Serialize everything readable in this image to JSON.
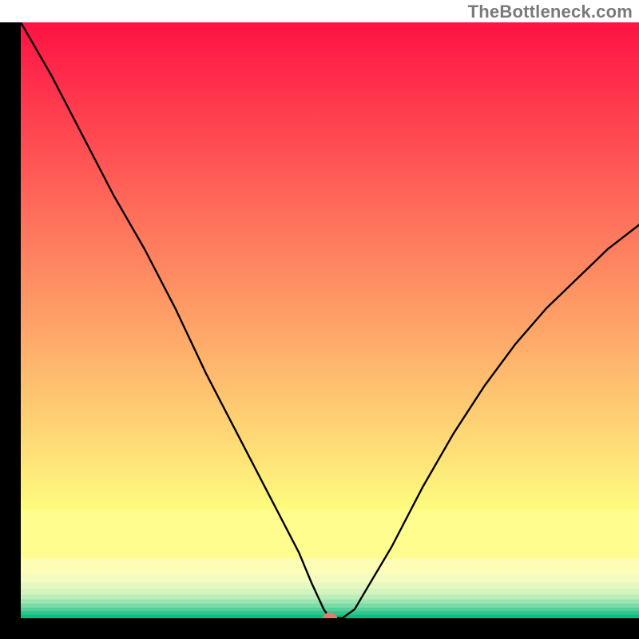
{
  "watermark": {
    "text": "TheBottleneck.com"
  },
  "chart_data": {
    "type": "line",
    "title": "",
    "xlabel": "",
    "ylabel": "",
    "xlim": [
      0,
      100
    ],
    "ylim": [
      0,
      100
    ],
    "grid": false,
    "legend": false,
    "series": [
      {
        "name": "curve",
        "x": [
          0,
          5,
          10,
          15,
          20,
          25,
          30,
          35,
          40,
          45,
          47,
          49,
          50,
          52,
          54,
          56,
          60,
          65,
          70,
          75,
          80,
          85,
          90,
          95,
          100
        ],
        "values": [
          100,
          91,
          81,
          71,
          62,
          52,
          41,
          31,
          21,
          11,
          6,
          1.5,
          0,
          0,
          1.5,
          5,
          12,
          22,
          31,
          39,
          46,
          52,
          57,
          62,
          66
        ]
      }
    ],
    "marker": {
      "x": 50,
      "y": 0,
      "color": "#d98072"
    },
    "background_bands": {
      "top_gradient": {
        "from": "#ff1244",
        "to": "#fefc7e"
      },
      "lower_bands": [
        {
          "color": "#fffd8e",
          "y0": 82,
          "y1": 90
        },
        {
          "color": "#fdfdb6",
          "y0": 90,
          "y1": 92.5
        },
        {
          "color": "#f3fbc0",
          "y0": 92.5,
          "y1": 94
        },
        {
          "color": "#e5f8bf",
          "y0": 94,
          "y1": 95
        },
        {
          "color": "#d3f4bd",
          "y0": 95,
          "y1": 96
        },
        {
          "color": "#bbeeb8",
          "y0": 96,
          "y1": 96.8
        },
        {
          "color": "#9de5b0",
          "y0": 96.8,
          "y1": 97.5
        },
        {
          "color": "#7adba5",
          "y0": 97.5,
          "y1": 98.2
        },
        {
          "color": "#54cf99",
          "y0": 98.2,
          "y1": 98.8
        },
        {
          "color": "#2fc58d",
          "y0": 98.8,
          "y1": 99.4
        },
        {
          "color": "#0abd82",
          "y0": 99.4,
          "y1": 100
        }
      ]
    },
    "frame": {
      "left": 0,
      "right": 0,
      "bottom": 0
    }
  }
}
